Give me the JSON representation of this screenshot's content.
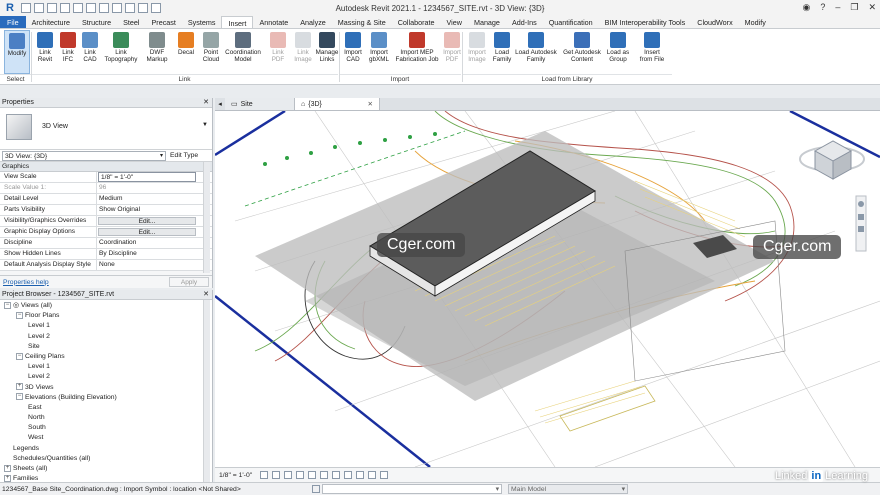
{
  "titlebar": {
    "title": "Autodesk Revit 2021.1 - 1234567_SITE.rvt - 3D View: {3D}",
    "app_letter": "R"
  },
  "tabs": [
    "File",
    "Architecture",
    "Structure",
    "Steel",
    "Precast",
    "Systems",
    "Insert",
    "Annotate",
    "Analyze",
    "Massing & Site",
    "Collaborate",
    "View",
    "Manage",
    "Add-Ins",
    "Quantification",
    "BIM Interoperability Tools",
    "CloudWorx",
    "Modify"
  ],
  "active_tab": "Insert",
  "ribbon": {
    "buttons": [
      {
        "l1": "Modify",
        "l2": ""
      },
      {
        "l1": "Link",
        "l2": "Revit"
      },
      {
        "l1": "Link",
        "l2": "IFC"
      },
      {
        "l1": "Link",
        "l2": "CAD"
      },
      {
        "l1": "Link",
        "l2": "Topography"
      },
      {
        "l1": "DWF",
        "l2": "Markup"
      },
      {
        "l1": "Decal",
        "l2": ""
      },
      {
        "l1": "Point",
        "l2": "Cloud"
      },
      {
        "l1": "Coordination",
        "l2": "Model"
      },
      {
        "l1": "Link",
        "l2": "PDF"
      },
      {
        "l1": "Link",
        "l2": "Image"
      },
      {
        "l1": "Manage",
        "l2": "Links"
      },
      {
        "l1": "Import",
        "l2": "CAD"
      },
      {
        "l1": "Import",
        "l2": "gbXML"
      },
      {
        "l1": "Import MEP",
        "l2": "Fabrication Job"
      },
      {
        "l1": "Import",
        "l2": "PDF"
      },
      {
        "l1": "Import",
        "l2": "Image"
      },
      {
        "l1": "Load",
        "l2": "Family"
      },
      {
        "l1": "Load Autodesk",
        "l2": "Family"
      },
      {
        "l1": "Get Autodesk",
        "l2": "Content"
      },
      {
        "l1": "Load as",
        "l2": "Group"
      },
      {
        "l1": "Insert",
        "l2": "from File"
      }
    ],
    "panels": [
      "Select",
      "Link",
      "Import",
      "Load from Library"
    ]
  },
  "properties": {
    "header": "Properties",
    "type_name": "3D View",
    "instance_selector": "3D View: {3D}",
    "edit_type": "Edit Type",
    "group": "Graphics",
    "rows": [
      {
        "name": "View Scale",
        "value": "1/8\" = 1'-0\""
      },
      {
        "name": "Scale Value    1:",
        "value": "96"
      },
      {
        "name": "Detail Level",
        "value": "Medium"
      },
      {
        "name": "Parts Visibility",
        "value": "Show Original"
      },
      {
        "name": "Visibility/Graphics Overrides",
        "value": "Edit..."
      },
      {
        "name": "Graphic Display Options",
        "value": "Edit..."
      },
      {
        "name": "Discipline",
        "value": "Coordination"
      },
      {
        "name": "Show Hidden Lines",
        "value": "By Discipline"
      },
      {
        "name": "Default Analysis Display Style",
        "value": "None"
      }
    ],
    "help_link": "Properties help",
    "apply_label": "Apply"
  },
  "browser": {
    "header": "Project Browser - 1234567_SITE.rvt",
    "nodes": [
      {
        "label": "Views (all)",
        "level": 0,
        "tw": "-",
        "icon": true
      },
      {
        "label": "Floor Plans",
        "level": 1,
        "tw": "-"
      },
      {
        "label": "Level 1",
        "level": 2,
        "tw": ""
      },
      {
        "label": "Level 2",
        "level": 2,
        "tw": ""
      },
      {
        "label": "Site",
        "level": 2,
        "tw": ""
      },
      {
        "label": "Ceiling Plans",
        "level": 1,
        "tw": "-"
      },
      {
        "label": "Level 1",
        "level": 2,
        "tw": ""
      },
      {
        "label": "Level 2",
        "level": 2,
        "tw": ""
      },
      {
        "label": "3D Views",
        "level": 1,
        "tw": "+"
      },
      {
        "label": "Elevations (Building Elevation)",
        "level": 1,
        "tw": "-"
      },
      {
        "label": "East",
        "level": 2,
        "tw": ""
      },
      {
        "label": "North",
        "level": 2,
        "tw": ""
      },
      {
        "label": "South",
        "level": 2,
        "tw": ""
      },
      {
        "label": "West",
        "level": 2,
        "tw": ""
      },
      {
        "label": "Legends",
        "level": 0,
        "tw": ""
      },
      {
        "label": "Schedules/Quantities (all)",
        "level": 0,
        "tw": ""
      },
      {
        "label": "Sheets (all)",
        "level": 0,
        "tw": "+"
      },
      {
        "label": "Families",
        "level": 0,
        "tw": "+"
      }
    ]
  },
  "view_tabs": [
    {
      "label": "Site",
      "active": false
    },
    {
      "label": "{3D}",
      "active": true
    }
  ],
  "view_control": {
    "scale": "1/8\" = 1'-0\""
  },
  "statusbar": {
    "message": "1234567_Base Site_Coordination.dwg : Import Symbol : location <Not Shared>",
    "model": "Main Model"
  },
  "watermarks": [
    "Cger.com",
    "Cger.com"
  ],
  "branding": {
    "pre": "Linked",
    "in": "in",
    "post": "Learning"
  },
  "colors": {
    "file_tab": "#2a6bbd",
    "blue_line": "#1a2f9e",
    "building_roof": "#5c5c5c",
    "site_paving": "#bdbdbd"
  }
}
